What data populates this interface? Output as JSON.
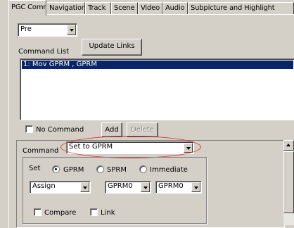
{
  "tabs": [
    {
      "label": "PGC Commands",
      "active": true
    },
    {
      "label": "Navigation"
    },
    {
      "label": "Track"
    },
    {
      "label": "Scene"
    },
    {
      "label": "Video"
    },
    {
      "label": "Audio"
    },
    {
      "label": "Subpicture and Highlight"
    }
  ],
  "top": {
    "mode_select": "Pre",
    "command_list_label": "Command List",
    "update_links_label": "Update Links",
    "commands": [
      "1: Mov GPRM , GPRM"
    ]
  },
  "actions": {
    "no_command_label": "No Command",
    "add_label": "Add",
    "delete_label": "Delete"
  },
  "editor": {
    "command_label": "Command",
    "command_value": "Set to GPRM",
    "set_label": "Set",
    "radio_gprm": "GPRM",
    "radio_sprm": "SPRM",
    "radio_immediate": "Immediate",
    "operation": "Assign",
    "target": "GPRM0",
    "source": "GPRM0",
    "compare_label": "Compare",
    "link_label": "Link"
  },
  "colors": {
    "selection": "#0a246a",
    "highlight_ring": "#e03030"
  }
}
